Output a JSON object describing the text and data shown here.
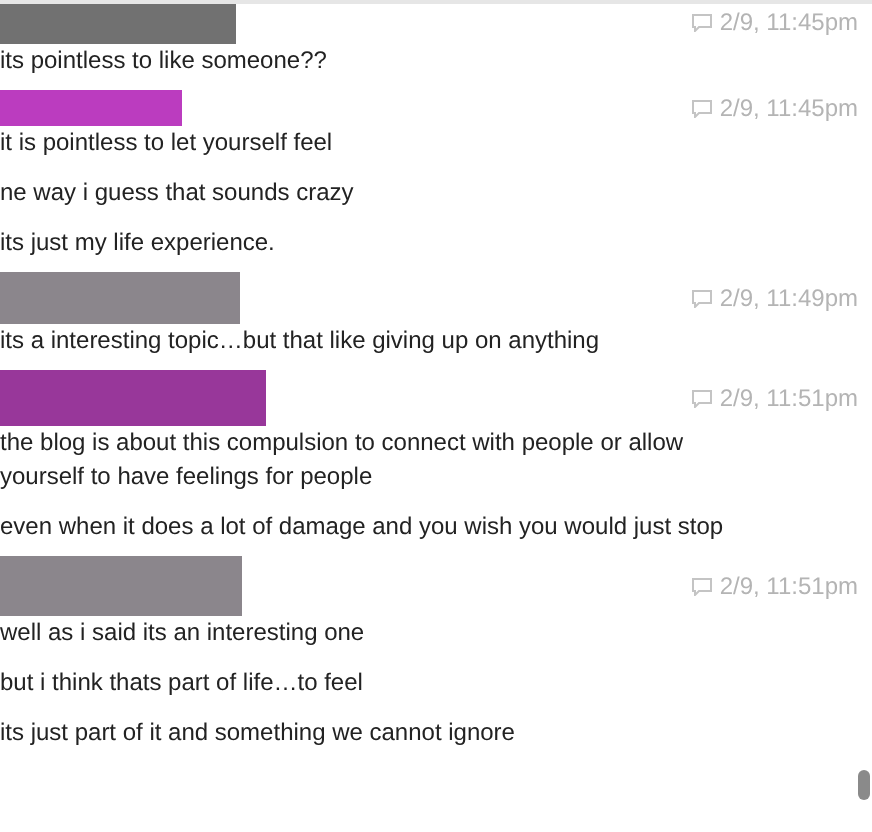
{
  "messages": [
    {
      "color": "#717171",
      "time": "2/9, 11:45pm",
      "lines": [
        "its pointless to like someone??"
      ]
    },
    {
      "color": "#bb3cbf",
      "time": "2/9, 11:45pm",
      "lines": [
        "it is pointless to let yourself feel",
        "ne way i guess that sounds crazy",
        "its just my life experience."
      ]
    },
    {
      "color": "#8b868c",
      "time": "2/9, 11:49pm",
      "lines": [
        "its a interesting topic…but that like giving up on anything"
      ]
    },
    {
      "color": "#98379a",
      "time": "2/9, 11:51pm",
      "lines": [
        "the blog is about this compulsion to connect with people or allow yourself to have feelings for people",
        "even when it does a lot of damage and you wish you would just stop"
      ]
    },
    {
      "color": "#8b868c",
      "time": "2/9, 11:51pm",
      "lines": [
        "well as i said its an interesting one",
        "but i think thats part of life…to feel",
        "its just part of it and something we cannot ignore"
      ]
    }
  ]
}
